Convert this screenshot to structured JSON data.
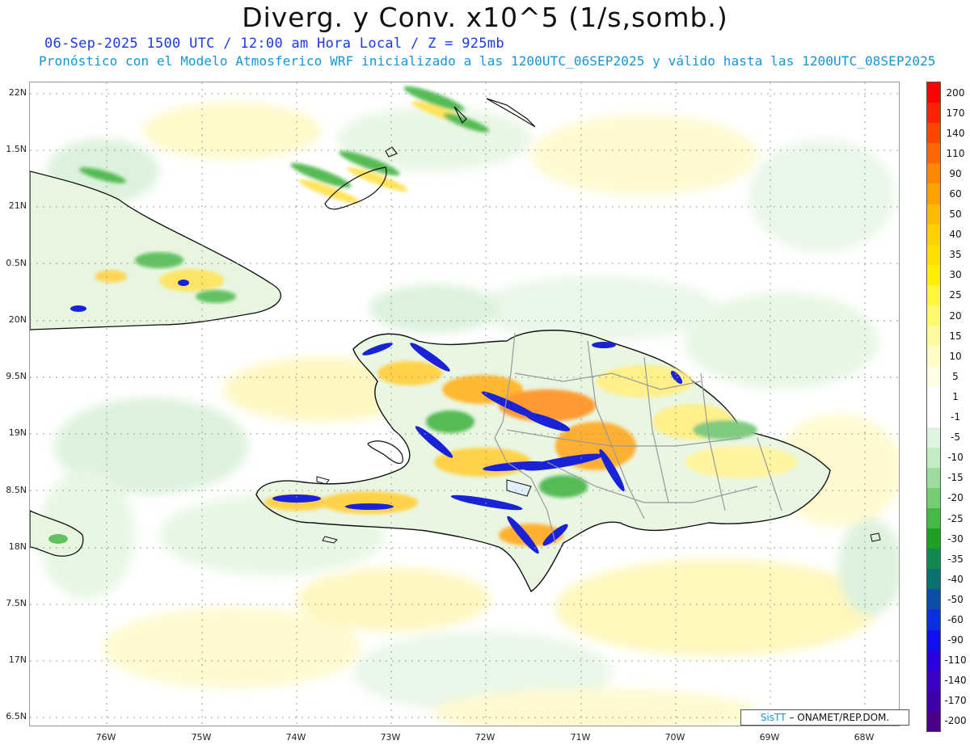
{
  "title": "Diverg. y Conv. x10^5 (1/s,somb.)",
  "subtitle_time": "06-Sep-2025 1500 UTC / 12:00 am Hora Local / Z = 925mb",
  "subtitle_model": "Pronóstico con el Modelo Atmosferico WRF inicializado a las 1200UTC_06SEP2025 y válido hasta las  1200UTC_08SEP2025",
  "lat_labels": [
    "22N",
    "1.5N",
    "21N",
    "0.5N",
    "20N",
    "9.5N",
    "19N",
    "8.5N",
    "18N",
    "7.5N",
    "17N",
    "6.5N"
  ],
  "lon_labels": [
    "76W",
    "75W",
    "74W",
    "73W",
    "72W",
    "71W",
    "70W",
    "69W",
    "68W"
  ],
  "colorbar": {
    "labels": [
      "200",
      "170",
      "140",
      "110",
      "90",
      "60",
      "50",
      "40",
      "35",
      "30",
      "25",
      "20",
      "15",
      "10",
      "5",
      "1",
      "-1",
      "-5",
      "-10",
      "-15",
      "-20",
      "-25",
      "-30",
      "-35",
      "-40",
      "-50",
      "-60",
      "-90",
      "-110",
      "-140",
      "-170",
      "-200"
    ],
    "colors": [
      "#ff0000",
      "#ff2200",
      "#ff4400",
      "#ff6600",
      "#ff8800",
      "#ffa200",
      "#ffbb00",
      "#ffd000",
      "#ffe000",
      "#ffee00",
      "#fff53a",
      "#fff970",
      "#fffaa0",
      "#fffcc8",
      "#fffee4",
      "#ffffff",
      "#ffffff",
      "#e0f5e0",
      "#c2ecc2",
      "#9edc9e",
      "#74cc74",
      "#45b845",
      "#20a020",
      "#108a50",
      "#0a7070",
      "#0a4ea8",
      "#0a2ee0",
      "#1010f0",
      "#2a00e0",
      "#3a00c8",
      "#4000a8",
      "#4a0088"
    ]
  },
  "credit": {
    "brand": "SisTT",
    "org": "– ONAMET/REP.DOM."
  }
}
